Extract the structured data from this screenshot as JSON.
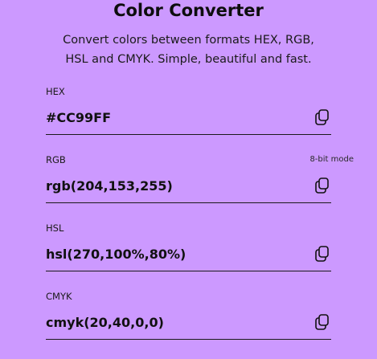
{
  "header": {
    "title": "Color Converter",
    "subtitle": "Convert colors between formats HEX, RGB, HSL and CMYK. Simple, beautiful and fast."
  },
  "fields": [
    {
      "label": "HEX",
      "value": "#CC99FF",
      "icon": "copy-icon"
    },
    {
      "label": "RGB",
      "value": "rgb(204,153,255)",
      "mode": "8-bit mode",
      "icon": "copy-icon"
    },
    {
      "label": "HSL",
      "value": "hsl(270,100%,80%)",
      "icon": "copy-icon"
    },
    {
      "label": "CMYK",
      "value": "cmyk(20,40,0,0)",
      "icon": "copy-icon"
    }
  ],
  "colors": {
    "background": "#cc99ff",
    "text": "#111111"
  }
}
